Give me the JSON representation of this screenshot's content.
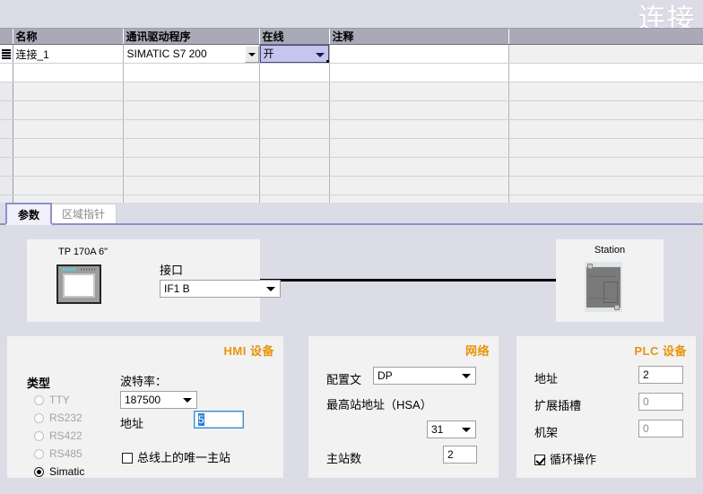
{
  "editor": {
    "title": "连接"
  },
  "table": {
    "columns": [
      "名称",
      "通讯驱动程序",
      "在线",
      "注释"
    ],
    "rows": [
      {
        "name": "连接_1",
        "driver": "SIMATIC S7 200",
        "online": "开",
        "comment": ""
      }
    ],
    "empty_row_count": 7
  },
  "tabs": [
    {
      "label": "参数",
      "active": true
    },
    {
      "label": "区域指针",
      "active": false
    }
  ],
  "topology": {
    "hmi": {
      "caption": "TP 170A 6\"",
      "interface_label": "接口",
      "interface_value": "IF1 B"
    },
    "plc": {
      "caption": "Station"
    }
  },
  "hmi_panel": {
    "title": "HMI 设备",
    "type_label": "类型",
    "types": [
      {
        "label": "TTY",
        "selected": false,
        "disabled": true
      },
      {
        "label": "RS232",
        "selected": false,
        "disabled": true
      },
      {
        "label": "RS422",
        "selected": false,
        "disabled": true
      },
      {
        "label": "RS485",
        "selected": false,
        "disabled": true
      },
      {
        "label": "Simatic",
        "selected": true,
        "disabled": false
      }
    ],
    "baud_label": "波特率：",
    "baud_value": "187500",
    "address_label": "地址",
    "address_value": "5",
    "only_master_label": "总线上的唯一主站",
    "only_master_checked": false
  },
  "network_panel": {
    "title": "网络",
    "profile_label": "配置文",
    "profile_value": "DP",
    "hsa_label": "最高站地址（HSA）",
    "hsa_value": "31",
    "masters_label": "主站数",
    "masters_value": "2"
  },
  "plc_panel": {
    "title": "PLC 设备",
    "address_label": "地址",
    "address_value": "2",
    "slot_label": "扩展插槽",
    "slot_value": "0",
    "rack_label": "机架",
    "rack_value": "0",
    "cyclic_label": "循环操作",
    "cyclic_checked": true
  },
  "colors": {
    "page_bg": "#dcdce6",
    "panel_bg": "#f2f2f2",
    "header_bg": "#a9a9b8",
    "accent_orange": "#E8940A",
    "tab_accent": "#8f8fd0",
    "cell_selection": "#c5c5f0",
    "text_selection": "#2b7fd4"
  }
}
